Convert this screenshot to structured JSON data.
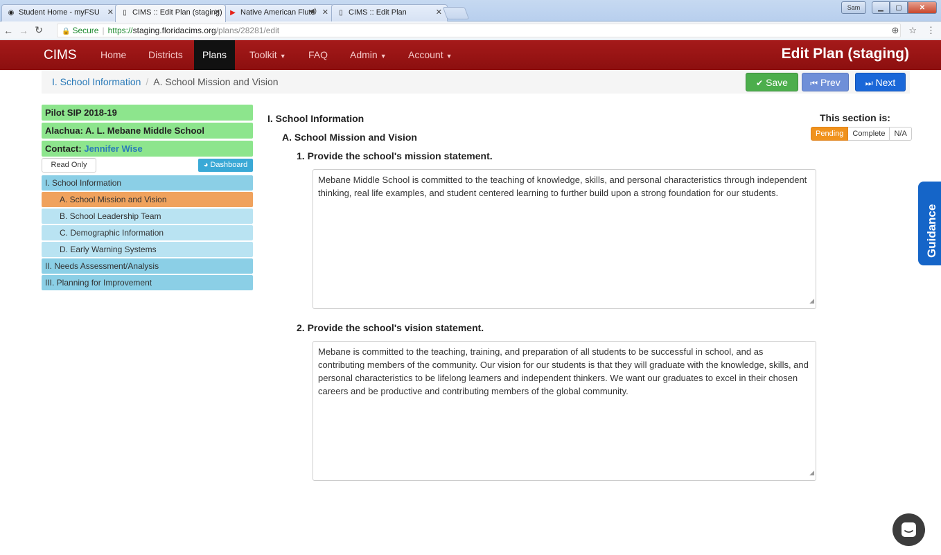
{
  "browser": {
    "tabs": [
      {
        "label": "Student Home - myFSU",
        "icon": "fsu-seal-icon"
      },
      {
        "label": "CIMS :: Edit Plan (staging)",
        "icon": "page-icon"
      },
      {
        "label": "Native American Flute",
        "icon": "youtube-icon"
      },
      {
        "label": "CIMS :: Edit Plan",
        "icon": "page-icon"
      }
    ],
    "url_secure": "Secure",
    "url_scheme": "https://",
    "url_host": "staging.floridacims.org",
    "url_path": "/plans/28281/edit",
    "user_button": "Sam"
  },
  "navbar": {
    "brand": "CIMS",
    "items": [
      "Home",
      "Districts",
      "Plans",
      "Toolkit",
      "FAQ",
      "Admin",
      "Account"
    ],
    "active": "Plans",
    "page_title": "Edit Plan (staging)"
  },
  "breadcrumb": {
    "parent": "I. School Information",
    "current": "A. School Mission and Vision"
  },
  "actions": {
    "save": "Save",
    "prev": "Prev",
    "next": "Next"
  },
  "sidebar": {
    "plan": "Pilot SIP 2018-19",
    "school": "Alachua: A. L. Mebane Middle School",
    "contact_label": "Contact:",
    "contact_name": "Jennifer Wise",
    "read_only": "Read Only",
    "dashboard": "Dashboard",
    "items": [
      {
        "label": "I.  School Information",
        "level": 1
      },
      {
        "label": "A. School Mission and Vision",
        "level": 2,
        "current": true
      },
      {
        "label": "B. School Leadership Team",
        "level": 2
      },
      {
        "label": "C. Demographic Information",
        "level": 2
      },
      {
        "label": "D. Early Warning Systems",
        "level": 2
      },
      {
        "label": "II.  Needs Assessment/Analysis",
        "level": 1
      },
      {
        "label": "III. Planning for Improvement",
        "level": 1
      }
    ]
  },
  "main": {
    "section": "I. School Information",
    "subsection": "A. School Mission and Vision",
    "q1": "1. Provide the school's mission statement.",
    "a1": "Mebane Middle School is committed to the teaching of knowledge, skills, and personal characteristics through independent thinking, real life examples, and student centered learning to further build upon a strong foundation for our students.",
    "q2": "2. Provide the school's vision statement.",
    "a2": "Mebane is committed to the teaching, training, and preparation of all students to be successful in school, and as contributing members of the community.  Our vision for our students is that they will graduate with the knowledge, skills, and personal characteristics to be lifelong learners and independent thinkers. We want our graduates to excel in their chosen careers and be productive and contributing members of the global community."
  },
  "status": {
    "label": "This section is:",
    "options": [
      "Pending",
      "Complete",
      "N/A"
    ],
    "selected": "Pending"
  },
  "guidance": "Guidance",
  "colors": {
    "navbar": "#9b1414",
    "sidebar_header": "#8de58d",
    "sidebar_section": "#8bcfe6",
    "sidebar_current": "#f0a25d",
    "save": "#4cae4c",
    "next": "#1a67d8",
    "status_pending": "#f0921c",
    "guidance": "#1565c8"
  }
}
